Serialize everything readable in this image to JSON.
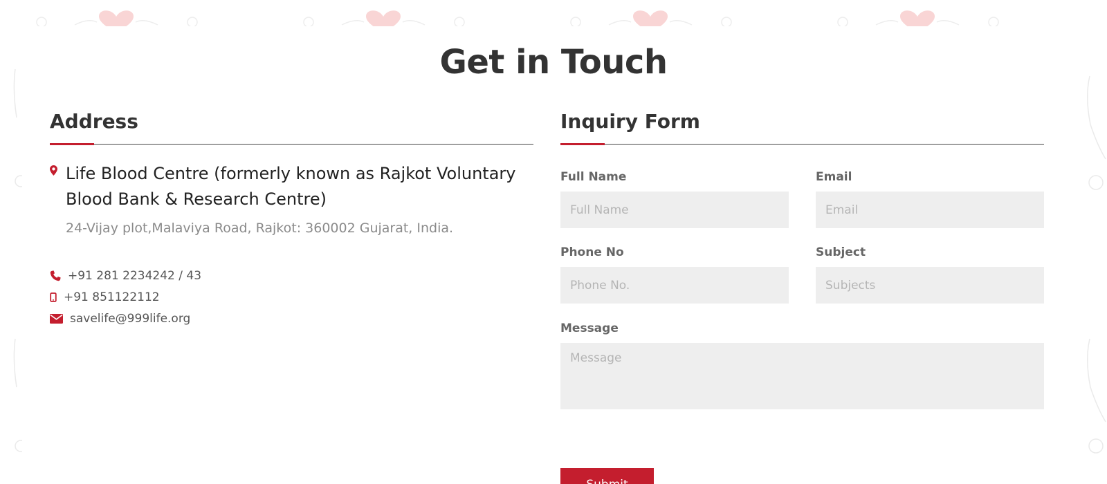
{
  "page": {
    "title": "Get in Touch"
  },
  "address": {
    "heading": "Address",
    "org_name": "Life Blood Centre (formerly known as Rajkot Voluntary Blood Bank & Research Centre)",
    "street": "24-Vijay plot,Malaviya Road, Rajkot: 360002 Gujarat, India.",
    "contacts": [
      {
        "icon": "phone-icon",
        "text": "+91 281 2234242 / 43"
      },
      {
        "icon": "mobile-icon",
        "text": "+91 851122112"
      },
      {
        "icon": "envelope-icon",
        "text": "savelife@999life.org"
      }
    ]
  },
  "form": {
    "heading": "Inquiry Form",
    "full_name": {
      "label": "Full Name",
      "placeholder": "Full Name",
      "value": ""
    },
    "email": {
      "label": "Email",
      "placeholder": "Email",
      "value": ""
    },
    "phone": {
      "label": "Phone No",
      "placeholder": "Phone No.",
      "value": ""
    },
    "subject": {
      "label": "Subject",
      "placeholder": "Subjects",
      "value": ""
    },
    "message": {
      "label": "Message",
      "placeholder": "Message",
      "value": ""
    },
    "submit_label": "Submit"
  },
  "colors": {
    "accent": "#c41e2e",
    "heading": "#333333",
    "field_bg": "#eeeeee",
    "muted_text": "#8a8a8a"
  }
}
